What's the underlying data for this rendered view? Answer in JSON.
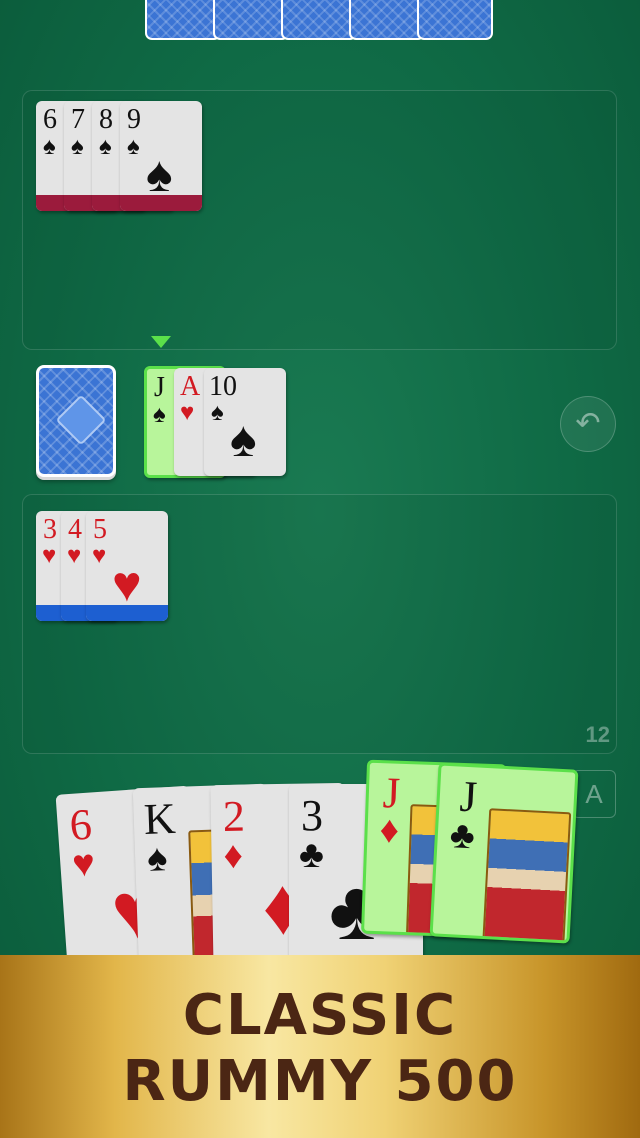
{
  "opponent": {
    "card_backs": 5
  },
  "opponent_melds": [
    {
      "rank": "6",
      "suit": "♠",
      "color": "black"
    },
    {
      "rank": "7",
      "suit": "♠",
      "color": "black"
    },
    {
      "rank": "8",
      "suit": "♠",
      "color": "black"
    },
    {
      "rank": "9",
      "suit": "♠",
      "color": "black"
    }
  ],
  "discard_pile": [
    {
      "rank": "J",
      "suit": "♠",
      "color": "black",
      "highlighted": true
    },
    {
      "rank": "A",
      "suit": "♥",
      "color": "red"
    },
    {
      "rank": "10",
      "suit": "♠",
      "color": "black"
    }
  ],
  "player_melds": [
    {
      "rank": "3",
      "suit": "♥",
      "color": "red"
    },
    {
      "rank": "4",
      "suit": "♥",
      "color": "red"
    },
    {
      "rank": "5",
      "suit": "♥",
      "color": "red"
    }
  ],
  "player_score": "12",
  "undo_icon": "↶",
  "sort_button_label": "A",
  "hand": [
    {
      "rank": "6",
      "suit": "♥",
      "color": "red"
    },
    {
      "rank": "K",
      "suit": "♠",
      "color": "black"
    },
    {
      "rank": "2",
      "suit": "♦",
      "color": "red"
    },
    {
      "rank": "3",
      "suit": "♣",
      "color": "black"
    },
    {
      "rank": "J",
      "suit": "♦",
      "color": "red",
      "highlighted": true
    },
    {
      "rank": "J",
      "suit": "♣",
      "color": "black",
      "highlighted": true
    }
  ],
  "colors": {
    "felt": "#0f6a45",
    "card_back": "#3b74d4",
    "highlight": "#5be04a",
    "opponent_stripe": "#9b1b3c",
    "player_stripe": "#1d5fd1",
    "banner_text": "#4b2614"
  },
  "banner": {
    "line1": "CLASSIC",
    "line2": "RUMMY 500"
  }
}
